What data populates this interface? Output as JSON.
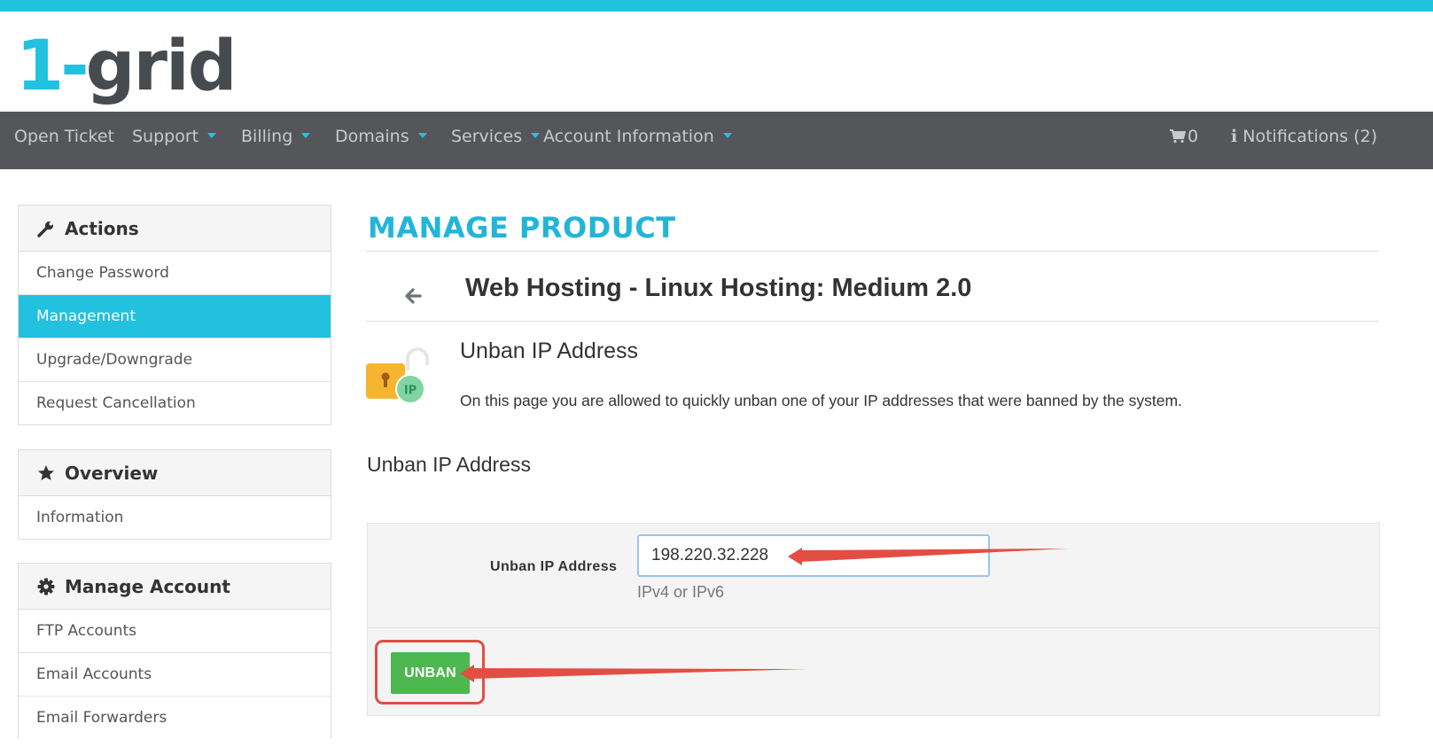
{
  "brand": {
    "logo_one": "1-",
    "logo_rest": "grid",
    "accent": "#22c1e0"
  },
  "nav": {
    "items": [
      {
        "label": "Open Ticket"
      },
      {
        "label": "Support"
      },
      {
        "label": "Billing"
      },
      {
        "label": "Domains"
      },
      {
        "label": "Services"
      },
      {
        "label": "Account Information"
      }
    ],
    "cart_count": "0",
    "notifications": "Notifications (2)"
  },
  "sidebar": {
    "actions": {
      "title": "Actions",
      "items": [
        "Change Password",
        "Management",
        "Upgrade/Downgrade",
        "Request Cancellation"
      ],
      "active": "Management"
    },
    "overview": {
      "title": "Overview",
      "items": [
        "Information"
      ]
    },
    "manage_account": {
      "title": "Manage Account",
      "items": [
        "FTP Accounts",
        "Email Accounts",
        "Email Forwarders"
      ]
    }
  },
  "main": {
    "title": "MANAGE PRODUCT",
    "product_title": "Web Hosting - Linux Hosting: Medium 2.0",
    "module": {
      "title": "Unban IP Address",
      "description": "On this page you are allowed to quickly unban one of your IP addresses that were banned by the system.",
      "icon_badge": "IP"
    },
    "section_label": "Unban IP Address",
    "form": {
      "field_label": "Unban IP Address",
      "ip_value": "198.220.32.228",
      "help_text": "IPv4 or IPv6",
      "submit_label": "UNBAN"
    }
  },
  "colors": {
    "button_green": "#4cb84f",
    "annotation_red": "#e24e43",
    "nav_bg": "#55565a"
  }
}
